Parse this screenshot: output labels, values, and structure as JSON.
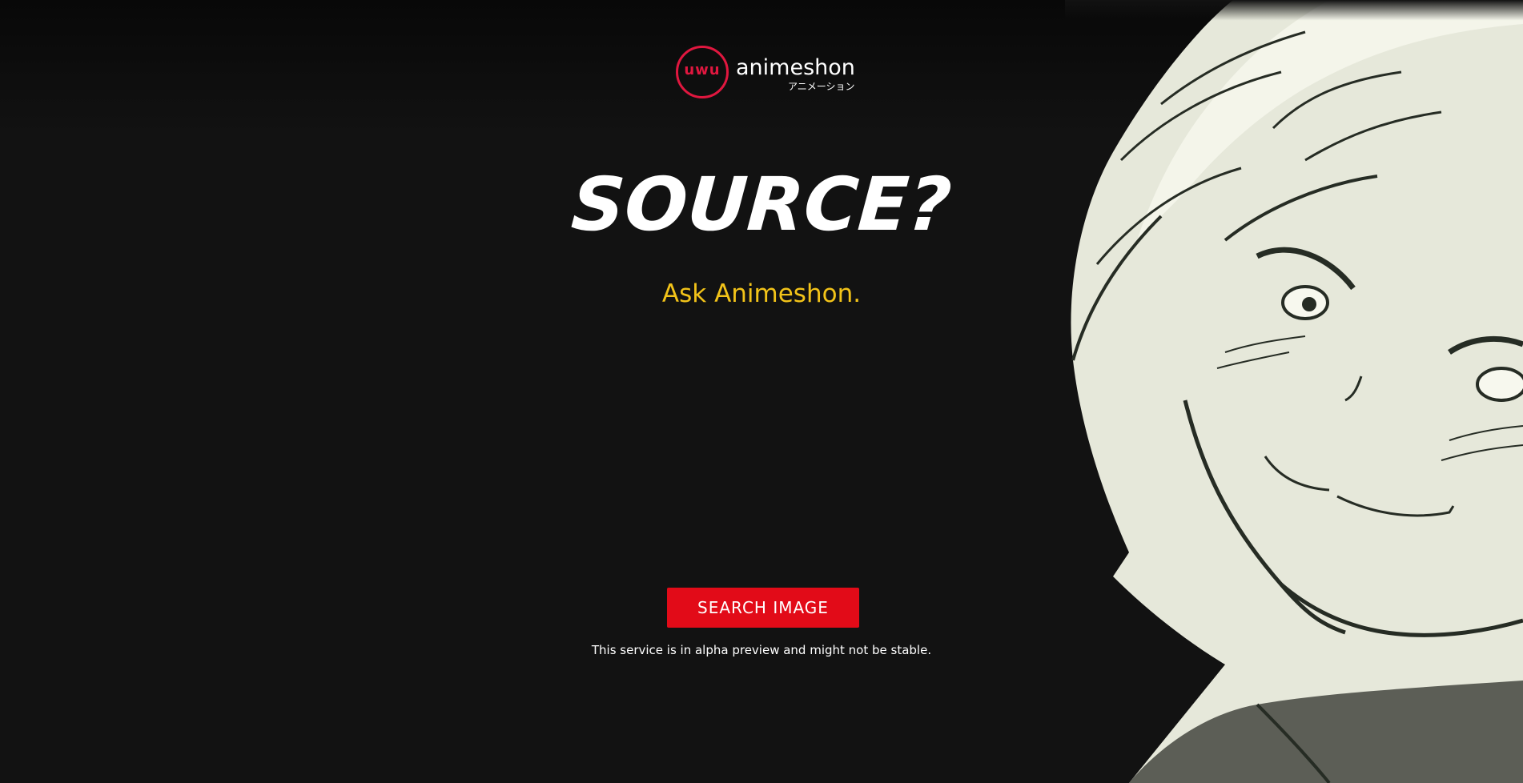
{
  "colors": {
    "background": "#121212",
    "brand_red": "#e0173f",
    "button_red": "#e20b18",
    "tagline_yellow": "#f2c319",
    "text": "#ffffff"
  },
  "logo": {
    "icon": "uwu-face-logo-icon",
    "face_text": "uwu",
    "name": "animeshon",
    "japanese": "アニメーション"
  },
  "hero": {
    "headline": "SOURCE?",
    "tagline": "Ask Animeshon."
  },
  "actions": {
    "search_label": "SEARCH IMAGE"
  },
  "footer": {
    "notice": "This service is in alpha preview and might not be stable."
  },
  "illustration": {
    "icon": "anime-character-illustration"
  }
}
